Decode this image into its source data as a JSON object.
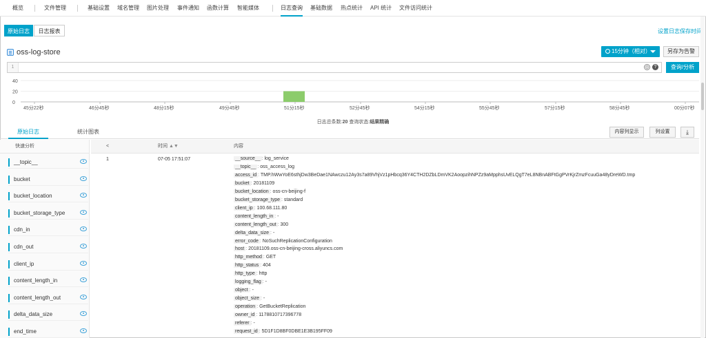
{
  "nav": {
    "items": [
      "概览",
      "文件管理",
      "基础设置",
      "域名管理",
      "图片处理",
      "事件通知",
      "函数计算",
      "智能媒体",
      "日志查询",
      "基础数据",
      "热点统计",
      "API 统计",
      "文件访问统计"
    ],
    "active_index": 8
  },
  "subtabs": [
    "原始日志",
    "日志报表"
  ],
  "retention_link": "设置日志保存时间",
  "store_name": "oss-log-store",
  "time_range": "15分钟（相对）",
  "save_alert": "另存为告警",
  "query": {
    "line_number": "1",
    "value": "",
    "search_label": "查询/分析"
  },
  "histogram": {
    "y_ticks": [
      "40",
      "20",
      "0"
    ],
    "x_ticks": [
      "45分22秒",
      "46分45秒",
      "48分15秒",
      "49分45秒",
      "51分15秒",
      "52分45秒",
      "54分15秒",
      "55分45秒",
      "57分15秒",
      "58分45秒",
      "00分07秒"
    ]
  },
  "chart_data": {
    "type": "bar",
    "ylim": [
      0,
      40
    ],
    "bar_values": [
      20
    ],
    "bar_label_start": "51分15秒",
    "color": "#8ccc6b"
  },
  "status": {
    "prefix": "日志总条数:",
    "count": "20",
    "state_label": " 查询状态:",
    "state": "结果精确"
  },
  "result_tabs": [
    "原始日志",
    "统计图表"
  ],
  "tools": {
    "content_col": "内容列显示",
    "col_settings": "列设置"
  },
  "sidebar": {
    "title": "快速分析",
    "fields": [
      "__topic__",
      "bucket",
      "bucket_location",
      "bucket_storage_type",
      "cdn_in",
      "cdn_out",
      "client_ip",
      "content_length_in",
      "content_length_out",
      "delta_data_size",
      "end_time"
    ]
  },
  "table": {
    "col_time": "时间",
    "col_content": "内容",
    "collapse": "<"
  },
  "log": {
    "index": "1",
    "time": "07-05 17:51:07",
    "entries": [
      {
        "k": "__source__",
        "v": "log_service"
      },
      {
        "k": "__topic__",
        "v": "oss_access_log"
      },
      {
        "k": "access_id",
        "v": "TMP.hWwYoE6sthjDw3BeDae1NAwczu12Ay3s7a89VhjVz1pHbcq36Y4CTH2DZbLDmVK2AoopzihNPZz9aMpphsUvELQgT7eL8NBnABFtGgPVrKjrZmzFcuuGa48yDreWD.tmp"
      },
      {
        "k": "bucket",
        "v": "20181109"
      },
      {
        "k": "bucket_location",
        "v": "oss-cn-beijing-f"
      },
      {
        "k": "bucket_storage_type",
        "v": "standard"
      },
      {
        "k": "client_ip",
        "v": "100.68.111.80"
      },
      {
        "k": "content_length_in",
        "v": "-"
      },
      {
        "k": "content_length_out",
        "v": "300"
      },
      {
        "k": "delta_data_size",
        "v": "-"
      },
      {
        "k": "error_code",
        "v": "NoSuchReplicationConfiguration"
      },
      {
        "k": "host",
        "v": "20181109.oss-cn-beijing-cross.aliyuncs.com"
      },
      {
        "k": "http_method",
        "v": "GET"
      },
      {
        "k": "http_status",
        "v": "404"
      },
      {
        "k": "http_type",
        "v": "http"
      },
      {
        "k": "logging_flag",
        "v": "-"
      },
      {
        "k": "object",
        "v": "-"
      },
      {
        "k": "object_size",
        "v": "-"
      },
      {
        "k": "operation",
        "v": "GetBucketReplication"
      },
      {
        "k": "owner_id",
        "v": "1178810717396778"
      },
      {
        "k": "referer",
        "v": "-"
      },
      {
        "k": "request_id",
        "v": "5D1F1D8BF0DBE1E3B195FF09"
      }
    ]
  }
}
